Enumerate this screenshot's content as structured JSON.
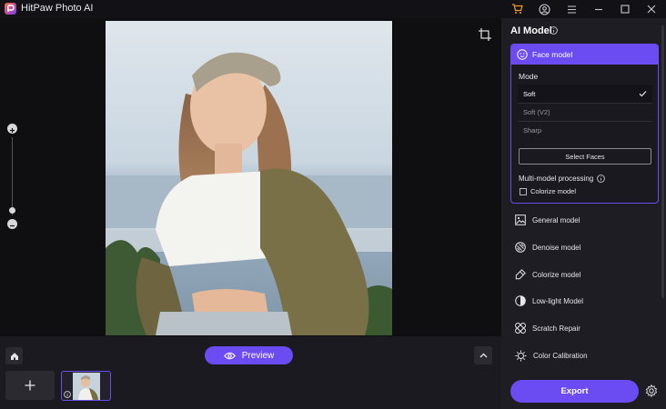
{
  "app": {
    "title": "HitPaw Photo AI"
  },
  "colors": {
    "accent": "#6b4cf2",
    "panel": "#1e1d24",
    "background": "#0f0f12"
  },
  "icons": [
    "app-logo-icon",
    "cart-icon",
    "user-icon",
    "menu-icon",
    "minimize-icon",
    "maximize-icon",
    "close-icon",
    "crop-icon",
    "zoom-in-icon",
    "zoom-out-icon",
    "home-icon",
    "eye-icon",
    "chevron-up-icon",
    "plus-icon",
    "info-icon",
    "face-icon",
    "check-icon",
    "gear-icon"
  ],
  "toolbar": {
    "preview_label": "Preview"
  },
  "panel": {
    "title": "AI Model",
    "face_model": {
      "label": "Face model",
      "mode_label": "Mode",
      "modes": [
        "Soft",
        "Soft (V2)",
        "Sharp"
      ],
      "selected_mode": "Soft",
      "select_faces_label": "Select Faces",
      "multi_model_label": "Multi-model processing",
      "colorize_label": "Colorize model",
      "colorize_checked": false
    },
    "models": [
      {
        "label": "General model",
        "icon": "general-model-icon"
      },
      {
        "label": "Denoise model",
        "icon": "denoise-model-icon"
      },
      {
        "label": "Colorize model",
        "icon": "colorize-model-icon"
      },
      {
        "label": "Low-light Model",
        "icon": "low-light-model-icon"
      },
      {
        "label": "Scratch Repair",
        "icon": "scratch-repair-icon"
      },
      {
        "label": "Color Calibration",
        "icon": "color-calibration-icon"
      }
    ],
    "export_label": "Export"
  }
}
